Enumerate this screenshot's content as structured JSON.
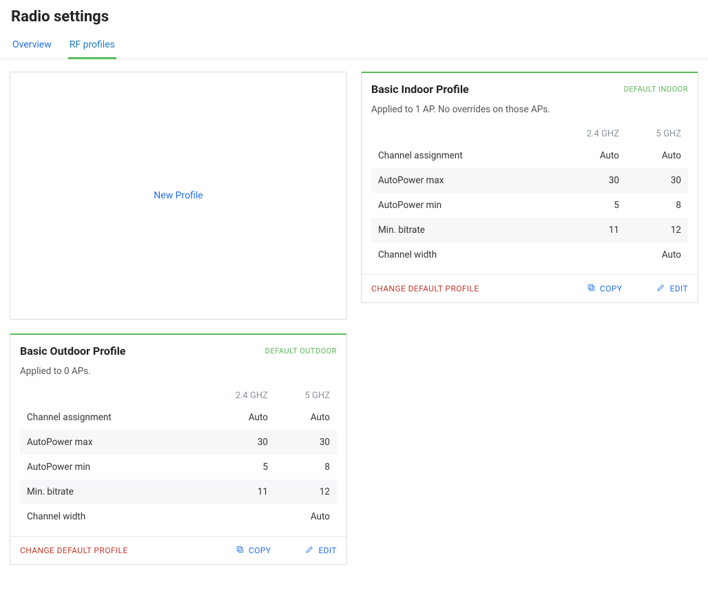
{
  "page_title": "Radio settings",
  "tabs": {
    "overview": "Overview",
    "rf_profiles": "RF profiles"
  },
  "new_profile_label": "New Profile",
  "columns": {
    "band24": "2.4 GHZ",
    "band5": "5 GHZ"
  },
  "row_labels": {
    "channel_assignment": "Channel assignment",
    "autopower_max": "AutoPower max",
    "autopower_min": "AutoPower min",
    "min_bitrate": "Min. bitrate",
    "channel_width": "Channel width"
  },
  "actions": {
    "change_default": "CHANGE DEFAULT PROFILE",
    "copy": "COPY",
    "edit": "EDIT"
  },
  "profiles": {
    "indoor": {
      "title": "Basic Indoor Profile",
      "badge": "DEFAULT INDOOR",
      "sub": "Applied to 1 AP. No overrides on those APs.",
      "rows": {
        "channel_assignment": {
          "b24": "Auto",
          "b5": "Auto"
        },
        "autopower_max": {
          "b24": "30",
          "b5": "30"
        },
        "autopower_min": {
          "b24": "5",
          "b5": "8"
        },
        "min_bitrate": {
          "b24": "11",
          "b5": "12"
        },
        "channel_width": {
          "b24": "",
          "b5": "Auto"
        }
      }
    },
    "outdoor": {
      "title": "Basic Outdoor Profile",
      "badge": "DEFAULT OUTDOOR",
      "sub": "Applied to 0 APs.",
      "rows": {
        "channel_assignment": {
          "b24": "Auto",
          "b5": "Auto"
        },
        "autopower_max": {
          "b24": "30",
          "b5": "30"
        },
        "autopower_min": {
          "b24": "5",
          "b5": "8"
        },
        "min_bitrate": {
          "b24": "11",
          "b5": "12"
        },
        "channel_width": {
          "b24": "",
          "b5": "Auto"
        }
      }
    }
  }
}
